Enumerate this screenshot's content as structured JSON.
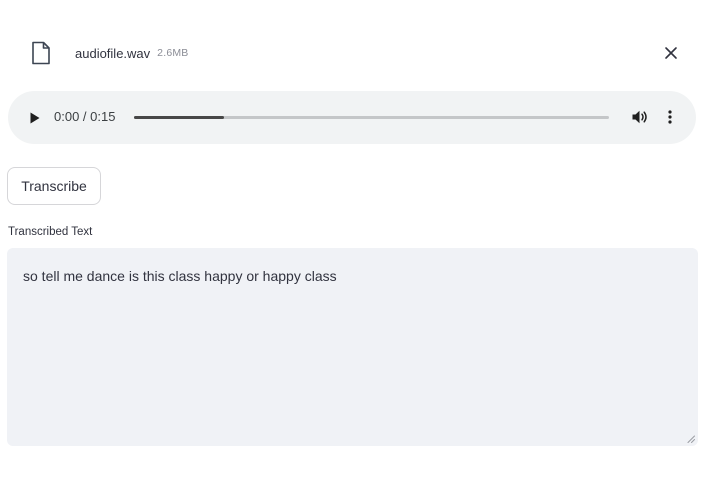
{
  "file": {
    "name": "audiofile.wav",
    "size": "2.6MB",
    "icon": "file-icon",
    "remove_icon": "close-icon"
  },
  "audio_player": {
    "time": "0:00 / 0:15",
    "progress": 0.0,
    "buffered_fraction": 0.19,
    "play_icon": "play-icon",
    "volume_icon": "volume-icon",
    "menu_icon": "more-vertical-icon"
  },
  "transcribe_button": {
    "label": "Transcribe"
  },
  "transcription": {
    "label": "Transcribed Text",
    "value": "so tell me dance is this class happy or happy class"
  },
  "colors": {
    "player_background": "#f1f3f4",
    "textarea_background": "#f0f2f6",
    "text": "#31333f"
  }
}
